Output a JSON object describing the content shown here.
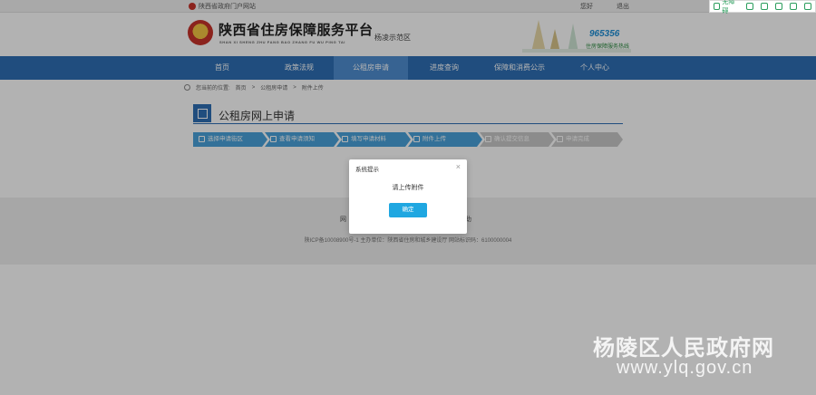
{
  "topbar": {
    "gov_link": "陕西省政府门户网站",
    "user": "您好",
    "logout": "退出"
  },
  "a11y": {
    "items": [
      "无障碍",
      "",
      "",
      "",
      "",
      ""
    ]
  },
  "header": {
    "title": "陕西省住房保障服务平台",
    "subtitle": "SHAN XI SHENG ZHU FANG BAO ZHANG FU WU PING TAI",
    "region": "杨凌示范区",
    "hotline": "965356",
    "hotline_label": "住房保障服务热线"
  },
  "nav": {
    "items": [
      "首页",
      "政策法规",
      "公租房申请",
      "进度查询",
      "保障和消费公示",
      "个人中心"
    ],
    "active_index": 2
  },
  "breadcrumb": {
    "label": "您当前的位置:",
    "items": [
      "首页",
      "公租房申请",
      "附件上传"
    ]
  },
  "section": {
    "title": "公租房网上申请"
  },
  "steps": [
    {
      "label": "选择申请街区",
      "state": "done"
    },
    {
      "label": "查看申请须知",
      "state": "done"
    },
    {
      "label": "填写申请材料",
      "state": "done"
    },
    {
      "label": "附件上传",
      "state": "done"
    },
    {
      "label": "确认提交信息",
      "state": "todo"
    },
    {
      "label": "申请完成",
      "state": "todo"
    }
  ],
  "footer": {
    "line1_left": "网",
    "line1_right": "助",
    "line2": "陕ICP备10008900号-1  主办单位：陕西省住房和城乡建设厅  网站标识码：6100000004"
  },
  "modal": {
    "title": "系统提示",
    "message": "请上传附件",
    "ok_label": "确定",
    "close_glyph": "×"
  },
  "watermark": {
    "line1": "杨陵区人民政府网",
    "line2": "www.ylq.gov.cn"
  },
  "colors": {
    "nav": "#2f6fb5",
    "step_done": "#4aa3db",
    "step_todo": "#c9c9c9",
    "ok_button": "#1fa7e1",
    "a11y": "#2a9d5c"
  }
}
